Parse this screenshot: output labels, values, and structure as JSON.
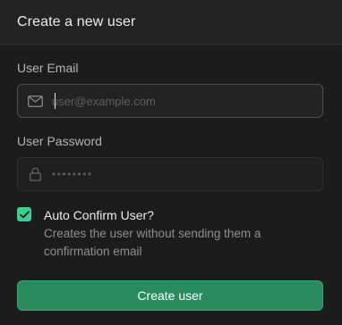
{
  "dialog": {
    "title": "Create a new user"
  },
  "email": {
    "label": "User Email",
    "placeholder": "user@example.com",
    "value": "",
    "icon": "mail-icon"
  },
  "password": {
    "label": "User Password",
    "masked_value": "••••••••",
    "icon": "lock-icon"
  },
  "auto_confirm": {
    "checked": true,
    "label": "Auto Confirm User?",
    "description": "Creates the user without sending them a confirmation email"
  },
  "submit": {
    "label": "Create user"
  },
  "colors": {
    "accent": "#3ecf8e",
    "button_bg": "#2a8c5e",
    "background": "#1c1c1c",
    "header_bg": "#232323"
  }
}
